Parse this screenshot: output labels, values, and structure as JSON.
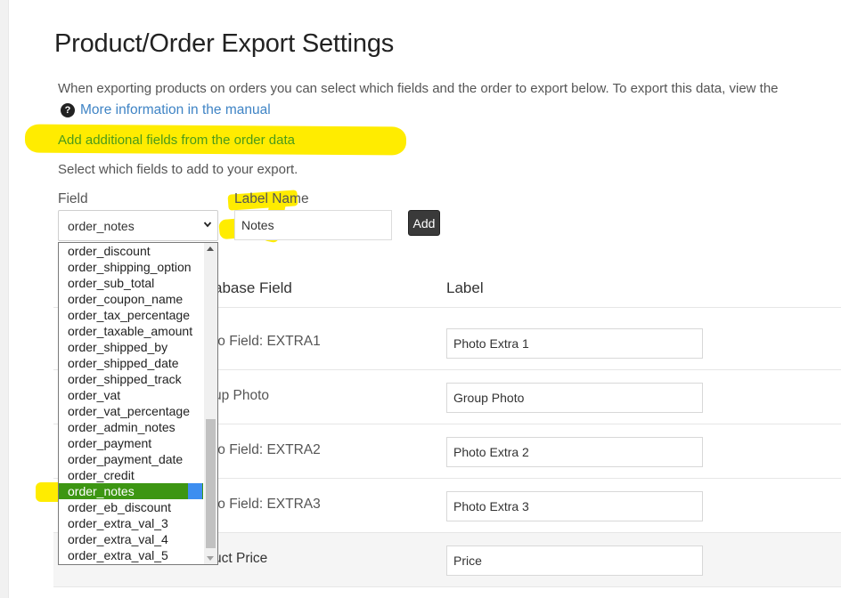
{
  "page": {
    "title": "Product/Order Export Settings",
    "intro": "When exporting products on orders you can select which fields and the order to export below. To export this data, view the",
    "manual_link": "More information in the manual",
    "add_fields_heading": "Add additional fields from the order data",
    "select_instruction": "Select which fields to add to your export."
  },
  "form": {
    "field_label": "Field",
    "field_value": "order_notes",
    "label_name_label": "Label Name",
    "label_name_value": "Notes",
    "add_button": "Add"
  },
  "dropdown": {
    "options": [
      "order_discount",
      "order_shipping_option",
      "order_sub_total",
      "order_coupon_name",
      "order_tax_percentage",
      "order_taxable_amount",
      "order_shipped_by",
      "order_shipped_date",
      "order_shipped_track",
      "order_vat",
      "order_vat_percentage",
      "order_admin_notes",
      "order_payment",
      "order_payment_date",
      "order_credit",
      "order_notes",
      "order_eb_discount",
      "order_extra_val_3",
      "order_extra_val_4",
      "order_extra_val_5"
    ],
    "selected": "order_notes"
  },
  "table": {
    "headers": {
      "db_field": "abase Field",
      "label": "Label"
    },
    "rows": [
      {
        "db_field": "to Field: EXTRA1",
        "label": "Photo Extra 1"
      },
      {
        "db_field": "up Photo",
        "label": "Group Photo"
      },
      {
        "db_field": "to Field: EXTRA2",
        "label": "Photo Extra 2"
      },
      {
        "db_field": "to Field: EXTRA3",
        "label": "Photo Extra 3"
      },
      {
        "db_field": "uct Price",
        "label": "Price"
      }
    ]
  },
  "colors": {
    "highlight": "#ffec00",
    "link": "#3f84c5",
    "green_text": "#4a9a1a",
    "selected_option": "#3d9613"
  },
  "icons": {
    "help": "question-circle-icon",
    "select_arrow": "chevron-down-icon"
  }
}
